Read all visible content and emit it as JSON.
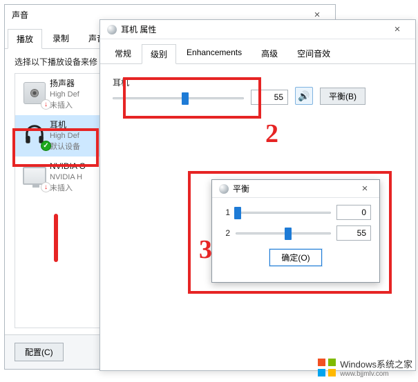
{
  "sound_window": {
    "title": "声音",
    "tabs": [
      "播放",
      "录制",
      "声音"
    ],
    "active_tab_index": 0,
    "instruction": "选择以下播放设备来修",
    "devices": [
      {
        "name": "扬声器",
        "desc": "High Def",
        "status": "未插入",
        "badge": "red"
      },
      {
        "name": "耳机",
        "desc": "High Def",
        "status": "默认设备",
        "badge": "green"
      },
      {
        "name": "NVIDIA O",
        "desc": "NVIDIA H",
        "status": "未插入",
        "badge": "red"
      }
    ],
    "configure_btn": "配置(C)"
  },
  "prop_window": {
    "title": "耳机 属性",
    "tabs": [
      "常规",
      "级别",
      "Enhancements",
      "高级",
      "空间音效"
    ],
    "active_tab_index": 1,
    "level": {
      "label": "耳机",
      "value": 55,
      "slider_pct": 55,
      "balance_btn": "平衡(B)"
    }
  },
  "balance_dialog": {
    "title": "平衡",
    "channels": [
      {
        "label": "1",
        "value": 0,
        "slider_pct": 2
      },
      {
        "label": "2",
        "value": 55,
        "slider_pct": 55
      }
    ],
    "ok_btn": "确定(O)"
  },
  "watermark": {
    "main": "Windows系统之家",
    "sub": "www.bjjmlv.com"
  },
  "annotations": {
    "num2": "2",
    "num3": "3"
  }
}
